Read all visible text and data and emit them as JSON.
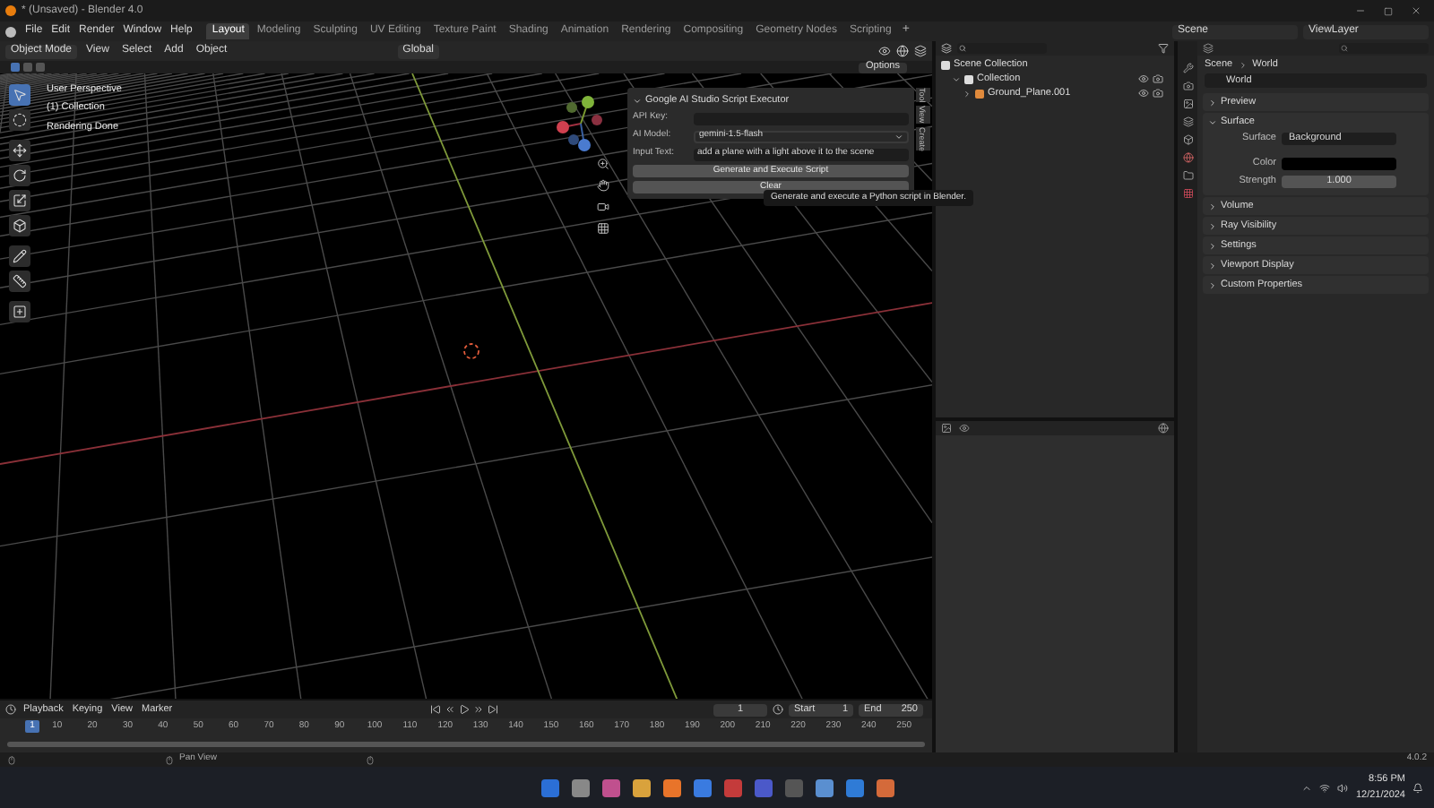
{
  "window": {
    "title": "* (Unsaved) - Blender 4.0"
  },
  "menu": [
    "File",
    "Edit",
    "Render",
    "Window",
    "Help"
  ],
  "workspaces": [
    {
      "label": "Layout",
      "selected": true
    },
    {
      "label": "Modeling",
      "selected": false
    },
    {
      "label": "Sculpting",
      "selected": false
    },
    {
      "label": "UV Editing",
      "selected": false
    },
    {
      "label": "Texture Paint",
      "selected": false
    },
    {
      "label": "Shading",
      "selected": false
    },
    {
      "label": "Animation",
      "selected": false
    },
    {
      "label": "Rendering",
      "selected": false
    },
    {
      "label": "Compositing",
      "selected": false
    },
    {
      "label": "Geometry Nodes",
      "selected": false
    },
    {
      "label": "Scripting",
      "selected": false
    }
  ],
  "add_workspace": "+",
  "scene": "Scene",
  "view_layer": "ViewLayer",
  "viewport": {
    "mode": "Object Mode",
    "menus": [
      "View",
      "Select",
      "Add",
      "Object"
    ],
    "orientation": "Global",
    "options": "Options",
    "overlay_text": [
      "User Perspective",
      "(1) Collection",
      "Rendering Done"
    ],
    "sidebar_tabs": [
      "Tool",
      "View",
      "Create"
    ]
  },
  "addon_panel": {
    "title": "Google AI Studio Script Executor",
    "expanded": true,
    "fields": [
      {
        "label": "API Key:",
        "kind": "text"
      },
      {
        "label": "AI Model:",
        "kind": "dropdown",
        "value": "gemini-1.5-flash"
      },
      {
        "label": "Input Text:",
        "kind": "text",
        "value": "add a plane with a light above it to the scene"
      }
    ],
    "buttons": [
      "Generate and Execute Script",
      "Clear"
    ],
    "tooltip": "Generate and execute a Python script in Blender."
  },
  "outliner": {
    "items": [
      {
        "label": "Scene Collection",
        "children": [
          {
            "label": "Collection",
            "expanded": true,
            "children": [
              {
                "label": "Ground_Plane.001",
                "expanded": false
              }
            ]
          }
        ]
      }
    ]
  },
  "properties": {
    "breadcrumb": [
      "Scene",
      "World"
    ],
    "datablock": "World",
    "sections": [
      {
        "label": "Preview",
        "expanded": false
      },
      {
        "label": "Surface",
        "expanded": true,
        "fields": [
          {
            "label": "Surface",
            "kind": "link",
            "value": "Background"
          },
          {
            "label": "Color",
            "kind": "color"
          },
          {
            "label": "Strength",
            "kind": "number",
            "value": "1.000"
          }
        ]
      },
      {
        "label": "Volume",
        "expanded": false
      },
      {
        "label": "Ray Visibility",
        "expanded": false
      },
      {
        "label": "Settings",
        "expanded": false
      },
      {
        "label": "Viewport Display",
        "expanded": false
      },
      {
        "label": "Custom Properties",
        "expanded": false
      }
    ]
  },
  "timeline": {
    "menus": [
      "Playback",
      "Keying",
      "View",
      "Marker"
    ],
    "current_frame": "1",
    "start_label": "Start",
    "start": "1",
    "end_label": "End",
    "end": "250",
    "playhead": "1",
    "ticks": [
      "10",
      "20",
      "30",
      "40",
      "50",
      "60",
      "70",
      "80",
      "90",
      "100",
      "110",
      "120",
      "130",
      "140",
      "150",
      "160",
      "170",
      "180",
      "190",
      "200",
      "210",
      "220",
      "230",
      "240",
      "250"
    ]
  },
  "status_bar": {
    "hint": "Pan View",
    "version": "4.0.2"
  },
  "taskbar": {
    "time": "8:56 PM",
    "date": "12/21/2024"
  }
}
